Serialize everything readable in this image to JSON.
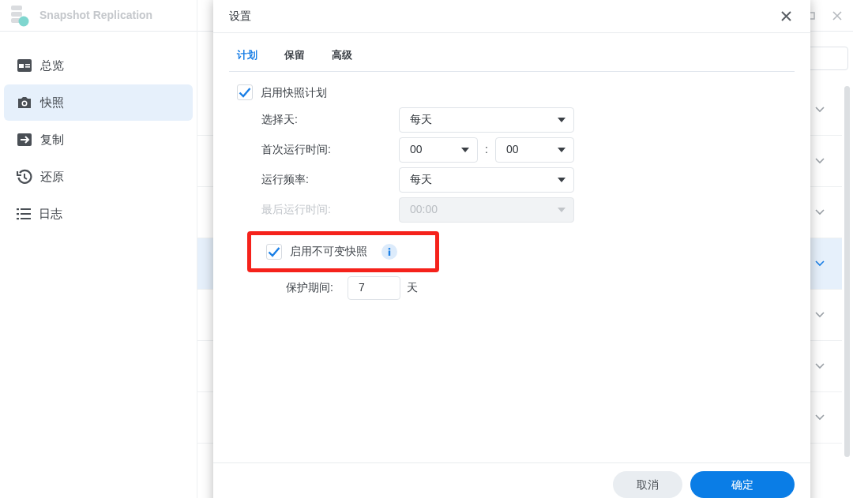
{
  "app": {
    "title": "Snapshot Replication"
  },
  "sidebar": {
    "items": [
      {
        "label": "总览",
        "kind": "overview",
        "selected": false
      },
      {
        "label": "快照",
        "kind": "camera",
        "selected": true
      },
      {
        "label": "复制",
        "kind": "replicate",
        "selected": false
      },
      {
        "label": "还原",
        "kind": "history",
        "selected": false
      },
      {
        "label": "日志",
        "kind": "list",
        "selected": false
      }
    ]
  },
  "list": {
    "rows": [
      {
        "selected": false
      },
      {
        "selected": false
      },
      {
        "selected": false
      },
      {
        "selected": true
      },
      {
        "selected": false
      },
      {
        "selected": false
      },
      {
        "selected": false
      }
    ]
  },
  "dialog": {
    "title": "设置",
    "tabs": [
      {
        "label": "计划",
        "selected": true
      },
      {
        "label": "保留",
        "selected": false
      },
      {
        "label": "高级",
        "selected": false
      }
    ],
    "enable_schedule": {
      "label": "启用快照计划",
      "checked": true
    },
    "fields": [
      {
        "kind": "select",
        "label": "选择天:",
        "value": "每天",
        "disabled": false
      },
      {
        "kind": "time",
        "label": "首次运行时间:",
        "hour": "00",
        "separator": ":",
        "minute": "00",
        "disabled": false
      },
      {
        "kind": "select",
        "label": "运行频率:",
        "value": "每天",
        "disabled": false
      },
      {
        "kind": "select",
        "label": "最后运行时间:",
        "value": "00:00",
        "disabled": true
      }
    ],
    "immutable": {
      "label": "启用不可变快照",
      "checked": true,
      "highlighted": true
    },
    "protection": {
      "label": "保护期间:",
      "value": "7",
      "unit": "天"
    },
    "buttons": [
      {
        "label": "取消",
        "kind": "secondary"
      },
      {
        "label": "确定",
        "kind": "primary"
      }
    ]
  }
}
